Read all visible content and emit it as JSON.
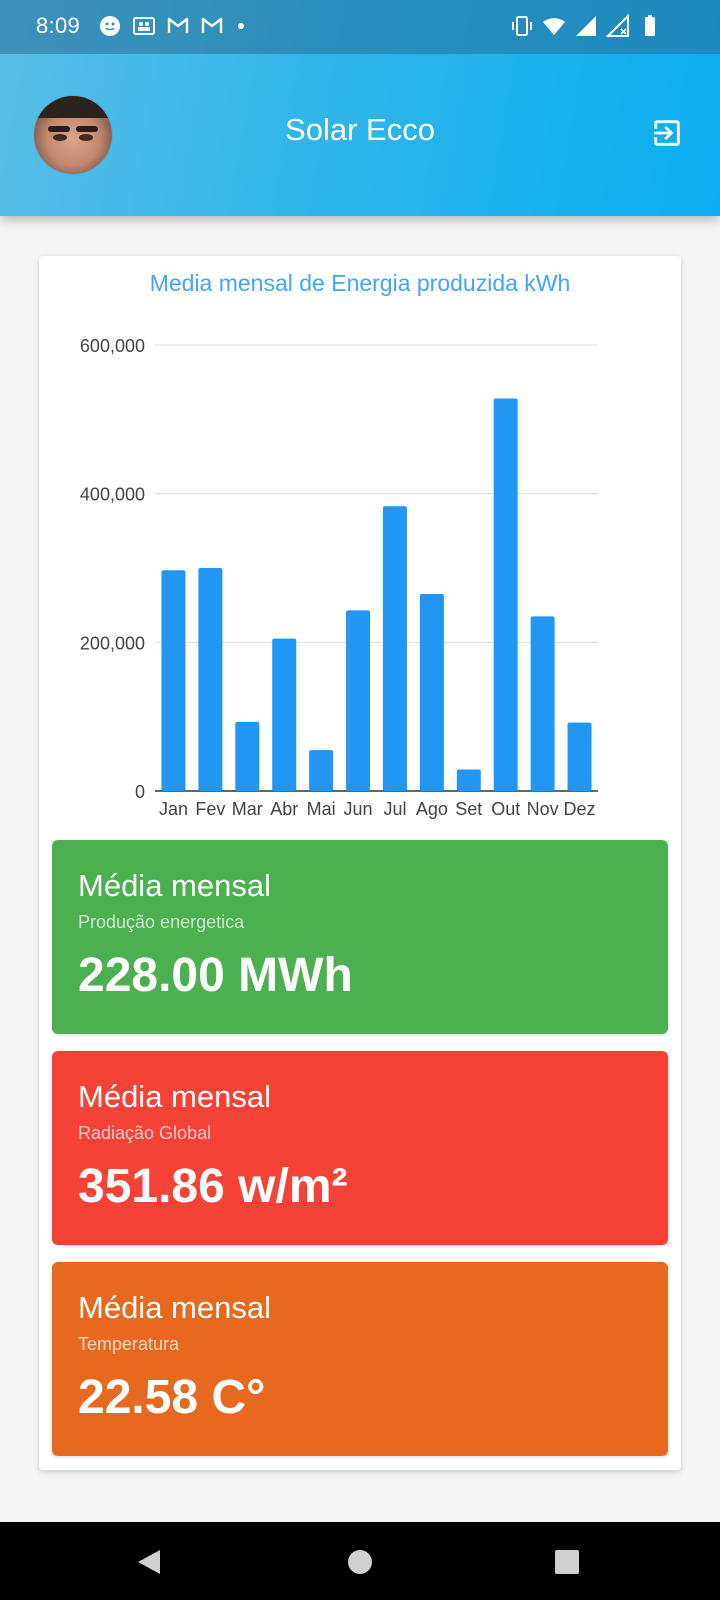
{
  "status_bar": {
    "time": "8:09",
    "left_icons": [
      "face-icon",
      "teams-icon",
      "gmail-icon",
      "gmail-icon",
      "dot-icon"
    ],
    "right_icons": [
      "vibrate-icon",
      "wifi-icon",
      "signal-icon",
      "signal-x-icon",
      "battery-icon"
    ]
  },
  "app_bar": {
    "title": "Solar Ecco",
    "avatar_icon": "user-avatar",
    "logout_icon": "logout-icon"
  },
  "colors": {
    "header_start": "#5bbde6",
    "header_end": "#0aaef0",
    "chart_bar": "#2196f3",
    "chart_title": "#42a5f5",
    "green": "#4caf50",
    "red": "#f44336",
    "orange": "#e6691f"
  },
  "chart_data": {
    "type": "bar",
    "title": "Media mensal de Energia produzida kWh",
    "categories": [
      "Jan",
      "Fev",
      "Mar",
      "Abr",
      "Mai",
      "Jun",
      "Jul",
      "Ago",
      "Set",
      "Out",
      "Nov",
      "Dez"
    ],
    "values": [
      297000,
      300000,
      93000,
      205000,
      55000,
      243000,
      383000,
      265000,
      29000,
      528000,
      235000,
      92000
    ],
    "ylim": [
      0,
      600000
    ],
    "yticks": [
      "0",
      "200,000",
      "400,000",
      "600,000"
    ],
    "ytick_values": [
      0,
      200000,
      400000,
      600000
    ],
    "grid": true,
    "xlabel": "",
    "ylabel": ""
  },
  "stats": [
    {
      "label": "Média mensal",
      "sub": "Produção energetica",
      "value": "228.00 MWh",
      "color": "green"
    },
    {
      "label": "Média mensal",
      "sub": "Radiação Global",
      "value": "351.86 w/m²",
      "color": "red"
    },
    {
      "label": "Média mensal",
      "sub": "Temperatura",
      "value": "22.58 C°",
      "color": "orange"
    }
  ],
  "nav_bar": {
    "icons": [
      "back-icon",
      "home-icon",
      "recents-icon"
    ]
  }
}
